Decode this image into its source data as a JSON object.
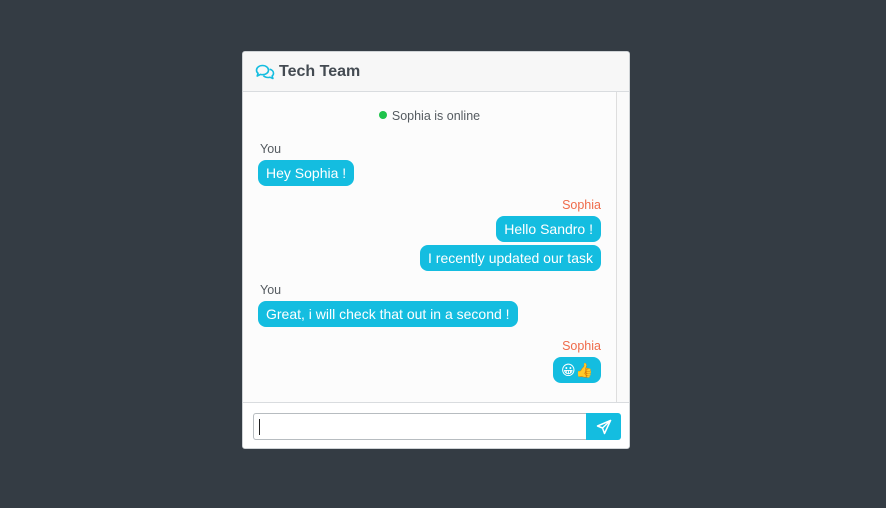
{
  "chat": {
    "title": "Tech Team",
    "online_status": "Sophia is online"
  },
  "messages": [
    {
      "sender": "You",
      "side": "me",
      "bubbles": [
        "Hey Sophia !"
      ]
    },
    {
      "sender": "Sophia",
      "side": "them",
      "bubbles": [
        "Hello Sandro !",
        "I recently updated our task"
      ]
    },
    {
      "sender": "You",
      "side": "me",
      "bubbles": [
        "Great, i will check that out in a second !"
      ]
    },
    {
      "sender": "Sophia",
      "side": "them",
      "bubbles": [
        "😀👍"
      ]
    }
  ],
  "composer": {
    "value": "",
    "placeholder": ""
  },
  "colors": {
    "accent": "#14bde0",
    "other_sender": "#ef6b4a",
    "online": "#1ec34b",
    "background": "#343c44"
  },
  "icons": {
    "header": "chat-bubbles-icon",
    "send": "paper-plane-icon"
  }
}
